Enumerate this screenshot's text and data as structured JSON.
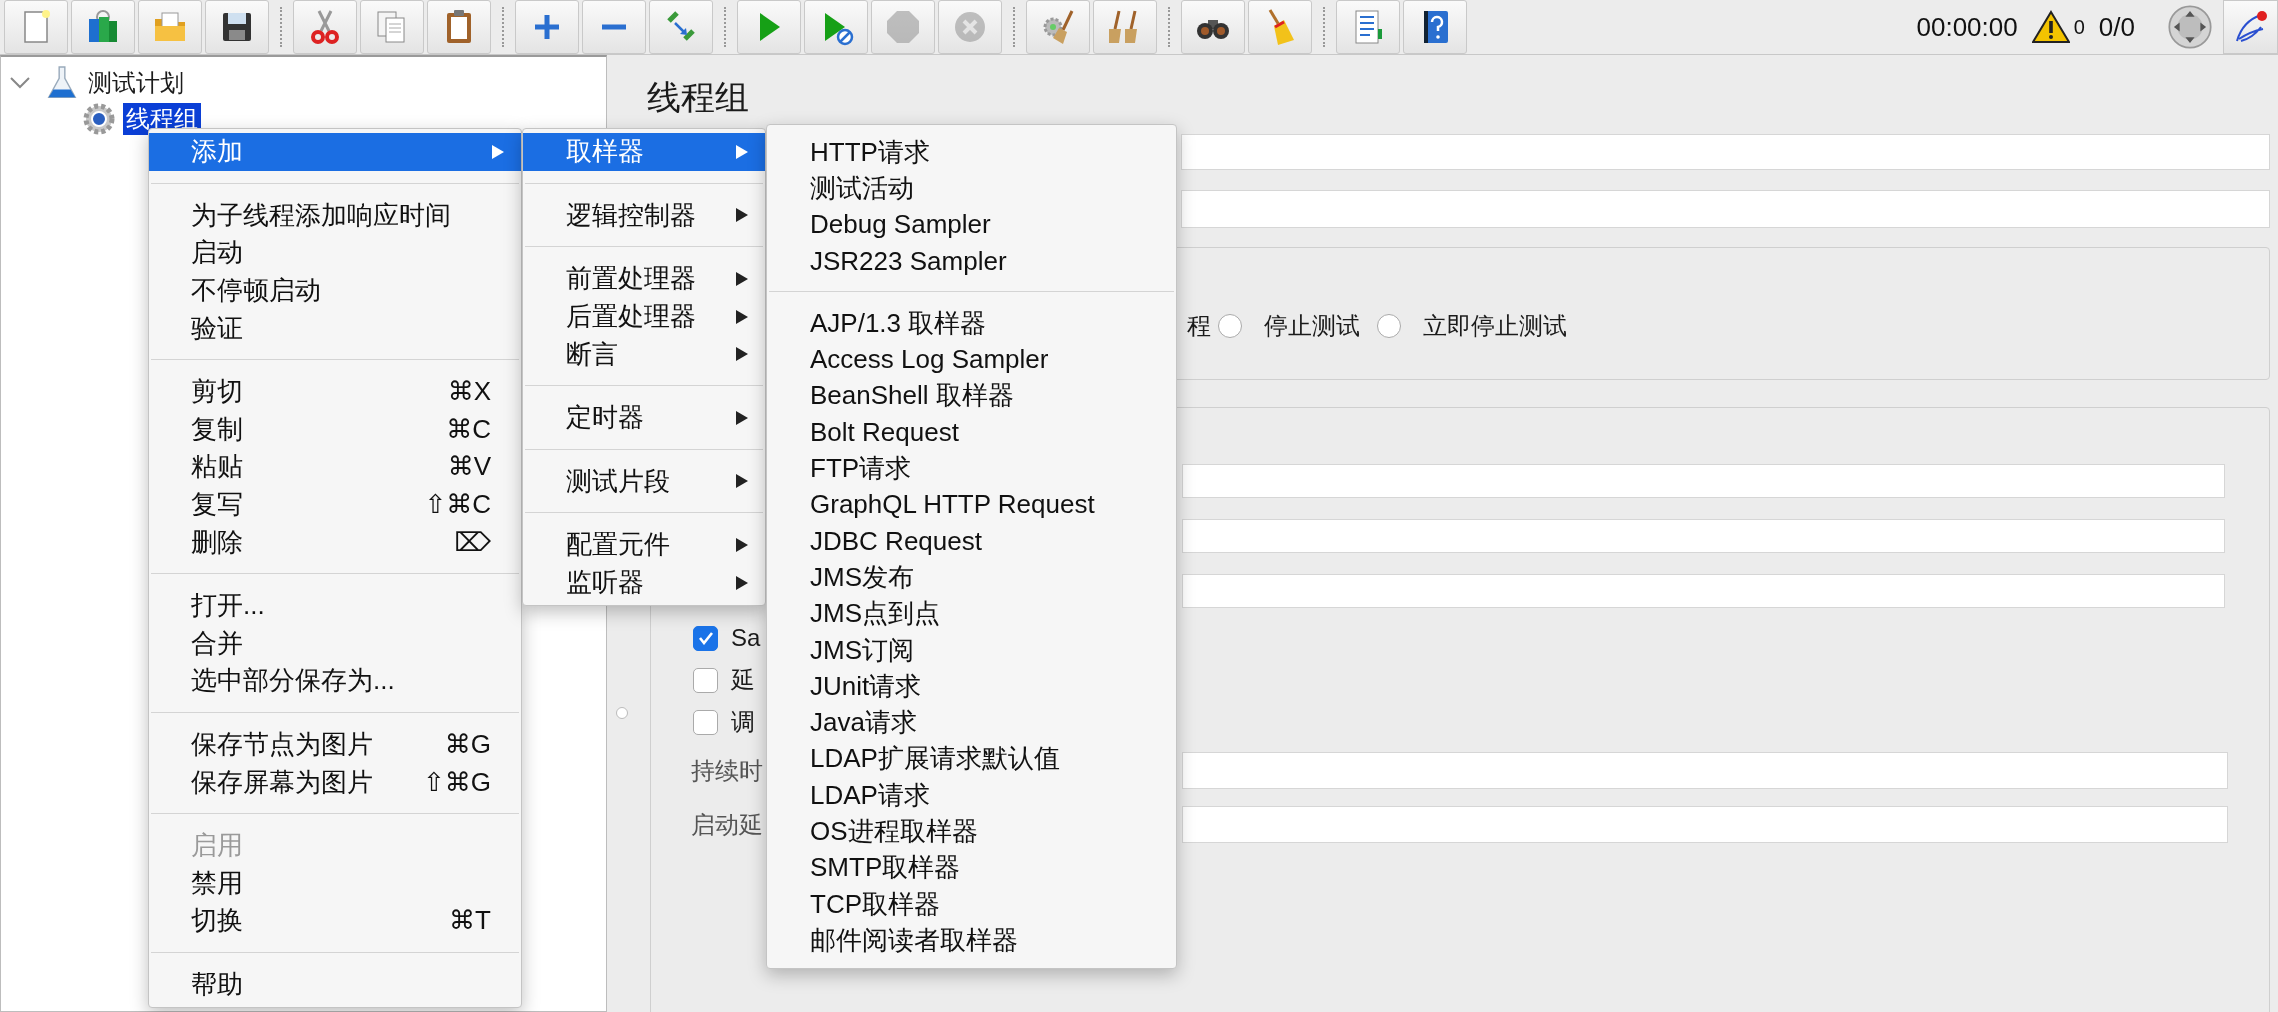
{
  "toolbar": {
    "items": [
      {
        "kind": "new",
        "disabled": false
      },
      {
        "kind": "templates",
        "disabled": false
      },
      {
        "kind": "open",
        "disabled": false
      },
      {
        "kind": "save",
        "disabled": false
      },
      {
        "kind": "separator"
      },
      {
        "kind": "cut",
        "disabled": false
      },
      {
        "kind": "copy",
        "disabled": false
      },
      {
        "kind": "paste",
        "disabled": false
      },
      {
        "kind": "separator"
      },
      {
        "kind": "expand",
        "disabled": false
      },
      {
        "kind": "collapse",
        "disabled": false
      },
      {
        "kind": "toggle",
        "disabled": false
      },
      {
        "kind": "separator"
      },
      {
        "kind": "start",
        "disabled": false
      },
      {
        "kind": "start-no-pause",
        "disabled": false
      },
      {
        "kind": "stop",
        "disabled": true
      },
      {
        "kind": "shutdown",
        "disabled": true
      },
      {
        "kind": "separator"
      },
      {
        "kind": "clear",
        "disabled": false
      },
      {
        "kind": "clear-all",
        "disabled": false
      },
      {
        "kind": "separator"
      },
      {
        "kind": "search",
        "disabled": false
      },
      {
        "kind": "reset-search",
        "disabled": false
      },
      {
        "kind": "separator"
      },
      {
        "kind": "function-helper",
        "disabled": false
      },
      {
        "kind": "help",
        "disabled": false
      }
    ],
    "timer": "00:00:00",
    "warnings": "0",
    "threads": "0/0"
  },
  "tree": [
    {
      "label": "测试计划",
      "kind": "plan",
      "expanded": true,
      "selected": false,
      "children": [
        {
          "label": "线程组",
          "kind": "thread-group",
          "selected": true
        }
      ]
    }
  ],
  "panel": {
    "title": "线程组",
    "error_action": {
      "fragment": "程",
      "options": [
        {
          "label": "停止测试",
          "selected": false
        },
        {
          "label": "立即停止测试",
          "selected": false
        }
      ]
    },
    "checkboxes": [
      {
        "label": "Sa",
        "checked": true
      },
      {
        "label": "延",
        "checked": false
      },
      {
        "label": "调",
        "checked": false
      }
    ],
    "labels": [
      "持续时",
      "启动延"
    ]
  },
  "context_menu": {
    "items": [
      {
        "kind": "item",
        "label": "添加",
        "submenu": true,
        "selected": true,
        "disabled": false
      },
      {
        "kind": "separator"
      },
      {
        "kind": "item",
        "label": "为子线程添加响应时间",
        "submenu": false,
        "selected": false,
        "disabled": false
      },
      {
        "kind": "item",
        "label": "启动",
        "submenu": false,
        "selected": false,
        "disabled": false
      },
      {
        "kind": "item",
        "label": "不停顿启动",
        "submenu": false,
        "selected": false,
        "disabled": false
      },
      {
        "kind": "item",
        "label": "验证",
        "submenu": false,
        "selected": false,
        "disabled": false
      },
      {
        "kind": "separator"
      },
      {
        "kind": "item",
        "label": "剪切",
        "shortcut": "⌘X",
        "submenu": false,
        "selected": false,
        "disabled": false
      },
      {
        "kind": "item",
        "label": "复制",
        "shortcut": "⌘C",
        "submenu": false,
        "selected": false,
        "disabled": false
      },
      {
        "kind": "item",
        "label": "粘贴",
        "shortcut": "⌘V",
        "submenu": false,
        "selected": false,
        "disabled": false
      },
      {
        "kind": "item",
        "label": "复写",
        "shortcut": "⇧⌘C",
        "submenu": false,
        "selected": false,
        "disabled": false
      },
      {
        "kind": "item",
        "label": "删除",
        "shortcut": "⌦",
        "submenu": false,
        "selected": false,
        "disabled": false
      },
      {
        "kind": "separator"
      },
      {
        "kind": "item",
        "label": "打开...",
        "submenu": false,
        "selected": false,
        "disabled": false
      },
      {
        "kind": "item",
        "label": "合并",
        "submenu": false,
        "selected": false,
        "disabled": false
      },
      {
        "kind": "item",
        "label": "选中部分保存为...",
        "submenu": false,
        "selected": false,
        "disabled": false
      },
      {
        "kind": "separator"
      },
      {
        "kind": "item",
        "label": "保存节点为图片",
        "shortcut": "⌘G",
        "submenu": false,
        "selected": false,
        "disabled": false
      },
      {
        "kind": "item",
        "label": "保存屏幕为图片",
        "shortcut": "⇧⌘G",
        "submenu": false,
        "selected": false,
        "disabled": false
      },
      {
        "kind": "separator"
      },
      {
        "kind": "item",
        "label": "启用",
        "submenu": false,
        "selected": false,
        "disabled": true
      },
      {
        "kind": "item",
        "label": "禁用",
        "submenu": false,
        "selected": false,
        "disabled": false
      },
      {
        "kind": "item",
        "label": "切换",
        "shortcut": "⌘T",
        "submenu": false,
        "selected": false,
        "disabled": false
      },
      {
        "kind": "separator"
      },
      {
        "kind": "item",
        "label": "帮助",
        "submenu": false,
        "selected": false,
        "disabled": false
      }
    ]
  },
  "add_submenu": {
    "items": [
      {
        "kind": "item",
        "label": "取样器",
        "submenu": true,
        "selected": true,
        "disabled": false
      },
      {
        "kind": "separator"
      },
      {
        "kind": "item",
        "label": "逻辑控制器",
        "submenu": true,
        "selected": false,
        "disabled": false
      },
      {
        "kind": "separator"
      },
      {
        "kind": "item",
        "label": "前置处理器",
        "submenu": true,
        "selected": false,
        "disabled": false
      },
      {
        "kind": "item",
        "label": "后置处理器",
        "submenu": true,
        "selected": false,
        "disabled": false
      },
      {
        "kind": "item",
        "label": "断言",
        "submenu": true,
        "selected": false,
        "disabled": false
      },
      {
        "kind": "separator"
      },
      {
        "kind": "item",
        "label": "定时器",
        "submenu": true,
        "selected": false,
        "disabled": false
      },
      {
        "kind": "separator"
      },
      {
        "kind": "item",
        "label": "测试片段",
        "submenu": true,
        "selected": false,
        "disabled": false
      },
      {
        "kind": "separator"
      },
      {
        "kind": "item",
        "label": "配置元件",
        "submenu": true,
        "selected": false,
        "disabled": false
      },
      {
        "kind": "item",
        "label": "监听器",
        "submenu": true,
        "selected": false,
        "disabled": false
      }
    ]
  },
  "sampler_submenu": {
    "items": [
      {
        "kind": "item",
        "label": "HTTP请求",
        "selected": false,
        "disabled": false
      },
      {
        "kind": "item",
        "label": "测试活动",
        "selected": false,
        "disabled": false
      },
      {
        "kind": "item",
        "label": "Debug Sampler",
        "selected": false,
        "disabled": false
      },
      {
        "kind": "item",
        "label": "JSR223 Sampler",
        "selected": false,
        "disabled": false
      },
      {
        "kind": "separator"
      },
      {
        "kind": "item",
        "label": "AJP/1.3 取样器",
        "selected": false,
        "disabled": false
      },
      {
        "kind": "item",
        "label": "Access Log Sampler",
        "selected": false,
        "disabled": false
      },
      {
        "kind": "item",
        "label": "BeanShell 取样器",
        "selected": false,
        "disabled": false
      },
      {
        "kind": "item",
        "label": "Bolt Request",
        "selected": false,
        "disabled": false
      },
      {
        "kind": "item",
        "label": "FTP请求",
        "selected": false,
        "disabled": false
      },
      {
        "kind": "item",
        "label": "GraphQL HTTP Request",
        "selected": false,
        "disabled": false
      },
      {
        "kind": "item",
        "label": "JDBC Request",
        "selected": false,
        "disabled": false
      },
      {
        "kind": "item",
        "label": "JMS发布",
        "selected": false,
        "disabled": false
      },
      {
        "kind": "item",
        "label": "JMS点到点",
        "selected": false,
        "disabled": false
      },
      {
        "kind": "item",
        "label": "JMS订阅",
        "selected": false,
        "disabled": false
      },
      {
        "kind": "item",
        "label": "JUnit请求",
        "selected": false,
        "disabled": false
      },
      {
        "kind": "item",
        "label": "Java请求",
        "selected": false,
        "disabled": false
      },
      {
        "kind": "item",
        "label": "LDAP扩展请求默认值",
        "selected": false,
        "disabled": false
      },
      {
        "kind": "item",
        "label": "LDAP请求",
        "selected": false,
        "disabled": false
      },
      {
        "kind": "item",
        "label": "OS进程取样器",
        "selected": false,
        "disabled": false
      },
      {
        "kind": "item",
        "label": "SMTP取样器",
        "selected": false,
        "disabled": false
      },
      {
        "kind": "item",
        "label": "TCP取样器",
        "selected": false,
        "disabled": false
      },
      {
        "kind": "item",
        "label": "邮件阅读者取样器",
        "selected": false,
        "disabled": false
      }
    ]
  }
}
